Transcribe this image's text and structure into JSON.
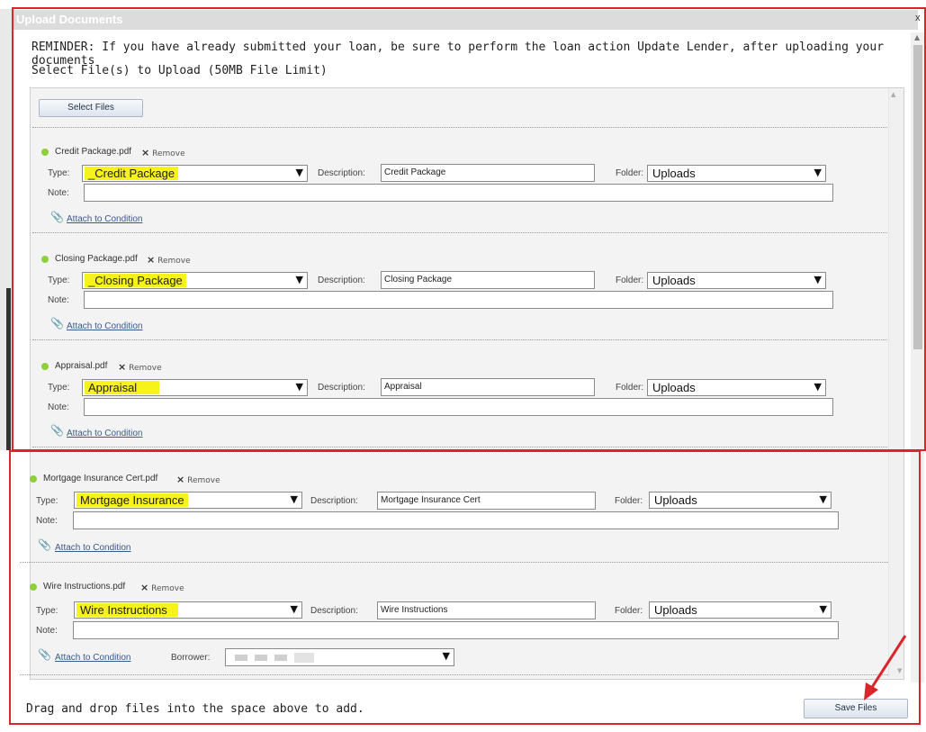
{
  "dialog": {
    "title": "Upload Documents",
    "close_label": "x",
    "reminder": "REMINDER: If you have already submitted your loan, be sure to perform the loan action Update Lender, after uploading your documents",
    "select_prompt": "Select File(s) to Upload (50MB File Limit)",
    "select_files_label": "Select Files",
    "drag_hint": "Drag and drop files into the space above to add.",
    "save_label": "Save Files"
  },
  "labels": {
    "type": "Type:",
    "description": "Description:",
    "folder": "Folder:",
    "note": "Note:",
    "remove": "Remove",
    "remove_x": "×",
    "attach": "Attach to Condition",
    "borrower": "Borrower:"
  },
  "files": [
    {
      "name": "Credit Package.pdf",
      "type": "_Credit Package",
      "description": "Credit Package",
      "folder": "Uploads",
      "note": ""
    },
    {
      "name": "Closing Package.pdf",
      "type": "_Closing Package",
      "description": "Closing Package",
      "folder": "Uploads",
      "note": ""
    },
    {
      "name": "Appraisal.pdf",
      "type": "Appraisal",
      "description": "Appraisal",
      "folder": "Uploads",
      "note": ""
    },
    {
      "name": "Mortgage Insurance Cert.pdf",
      "type": "Mortgage Insurance",
      "description": "Mortgage Insurance Cert",
      "folder": "Uploads",
      "note": ""
    },
    {
      "name": "Wire Instructions.pdf",
      "type": "Wire Instructions",
      "description": "Wire Instructions",
      "folder": "Uploads",
      "note": ""
    }
  ],
  "colors": {
    "highlight": "#f7f219",
    "annotation_red": "#d9262b",
    "status_dot": "#8fcf3c"
  }
}
